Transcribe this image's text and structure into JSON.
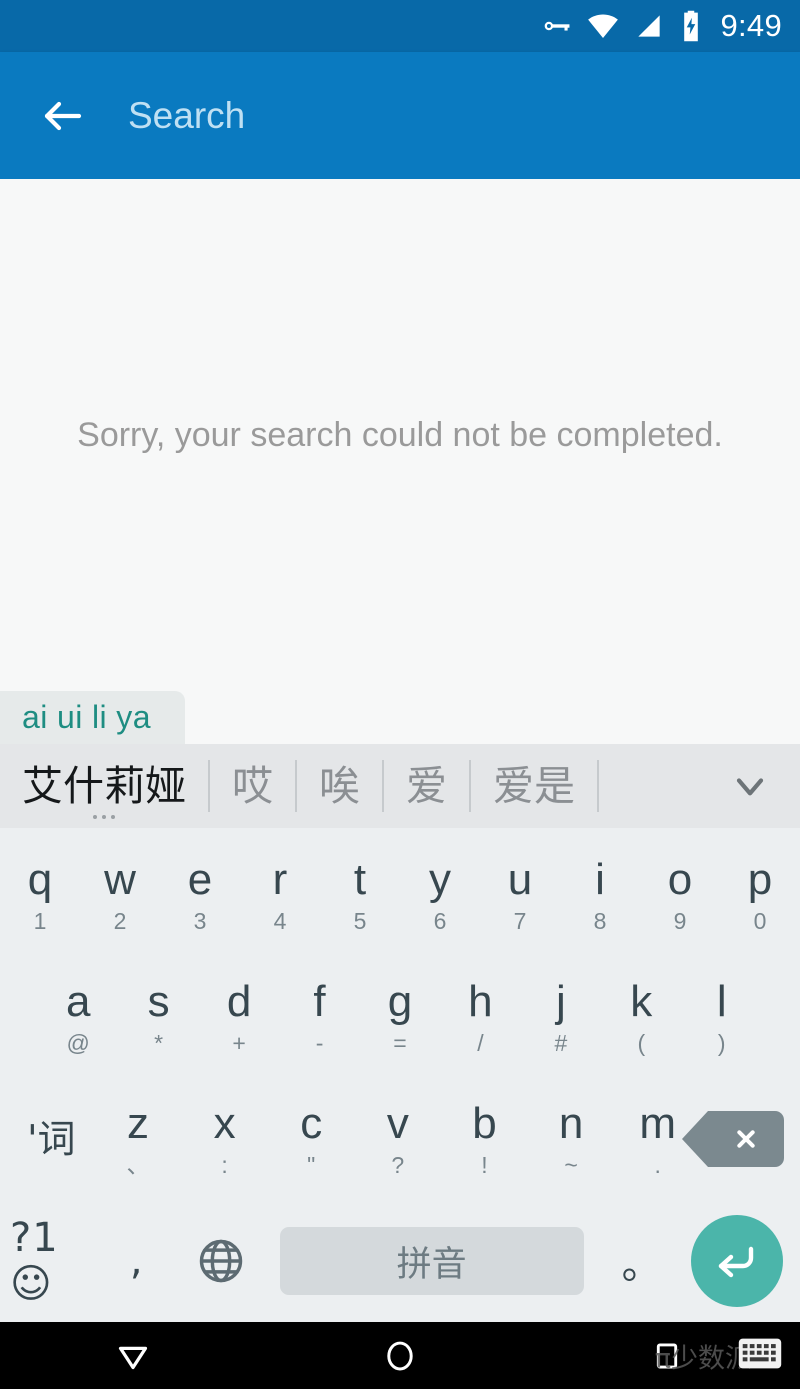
{
  "status_bar": {
    "time": "9:49",
    "icons": [
      "vpn-key-icon",
      "wifi-icon",
      "cellular-signal-icon",
      "battery-charging-icon"
    ],
    "background_color": "#0869a8"
  },
  "app_bar": {
    "back_label": "back-arrow",
    "search_placeholder": "Search",
    "background_color": "#0a7ac0",
    "placeholder_color": "#bfe0f3"
  },
  "content": {
    "error_message": "Sorry, your search could not be completed.",
    "background_color": "#f7f8f8",
    "text_color": "#9a9a9a"
  },
  "ime": {
    "composing_text": "ai ui li ya",
    "composing_color": "#1e8d82",
    "candidates": [
      {
        "text": "艾什莉娅",
        "selected": true
      },
      {
        "text": "哎",
        "selected": false
      },
      {
        "text": "唉",
        "selected": false
      },
      {
        "text": "爱",
        "selected": false
      },
      {
        "text": "爱是",
        "selected": false
      }
    ],
    "expand_icon": "chevron-down-icon",
    "candidate_bar_color": "#e4e6e8"
  },
  "keyboard": {
    "background_color": "#eceff1",
    "row1": [
      {
        "main": "q",
        "sub": "1"
      },
      {
        "main": "w",
        "sub": "2"
      },
      {
        "main": "e",
        "sub": "3"
      },
      {
        "main": "r",
        "sub": "4"
      },
      {
        "main": "t",
        "sub": "5"
      },
      {
        "main": "y",
        "sub": "6"
      },
      {
        "main": "u",
        "sub": "7"
      },
      {
        "main": "i",
        "sub": "8"
      },
      {
        "main": "o",
        "sub": "9"
      },
      {
        "main": "p",
        "sub": "0"
      }
    ],
    "row2": [
      {
        "main": "a",
        "sub": "@"
      },
      {
        "main": "s",
        "sub": "*"
      },
      {
        "main": "d",
        "sub": "+"
      },
      {
        "main": "f",
        "sub": "-"
      },
      {
        "main": "g",
        "sub": "="
      },
      {
        "main": "h",
        "sub": "/"
      },
      {
        "main": "j",
        "sub": "#"
      },
      {
        "main": "k",
        "sub": "("
      },
      {
        "main": "l",
        "sub": ")"
      }
    ],
    "row3_word_key": "'词",
    "row3": [
      {
        "main": "z",
        "sub": "、"
      },
      {
        "main": "x",
        "sub": ":"
      },
      {
        "main": "c",
        "sub": "\""
      },
      {
        "main": "v",
        "sub": "?"
      },
      {
        "main": "b",
        "sub": "!"
      },
      {
        "main": "n",
        "sub": "~"
      },
      {
        "main": "m",
        "sub": "."
      }
    ],
    "backspace_icon": "backspace-icon",
    "row4": {
      "symbols_key": "?1☺",
      "comma_key": ",",
      "globe_icon": "language-globe-icon",
      "space_label": "拼音",
      "period_key": "。",
      "enter_icon": "enter-return-icon",
      "space_color": "#d4d9dc",
      "enter_color": "#4bb5aa"
    }
  },
  "nav_bar": {
    "buttons": [
      "hide-keyboard-triangle-icon",
      "home-circle-icon",
      "recents-square-icon"
    ],
    "keyboard_icon": "keyboard-switch-icon",
    "watermark": "π少数派",
    "background_color": "#000000"
  }
}
